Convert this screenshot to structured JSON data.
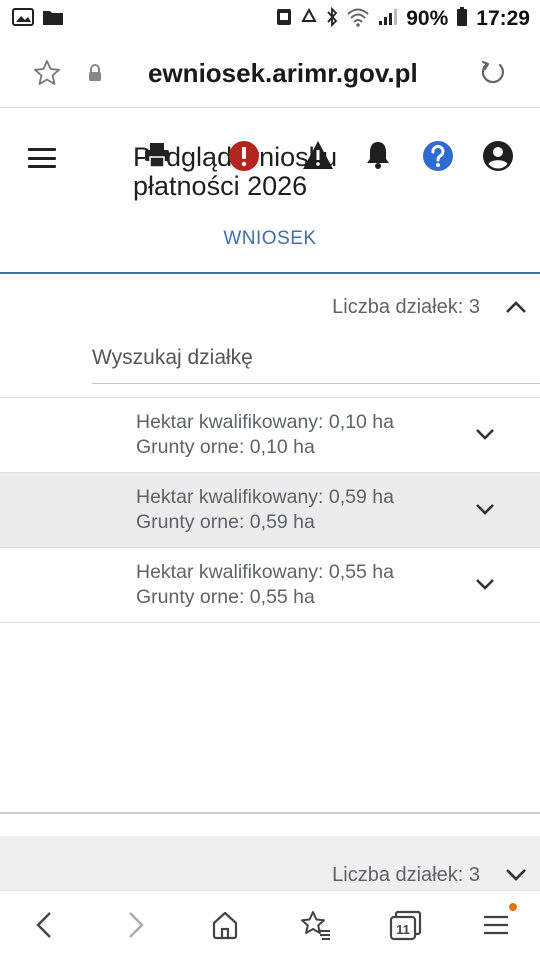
{
  "status_bar": {
    "battery_percent": "90%",
    "time": "17:29"
  },
  "browser": {
    "url": "ewniosek.arimr.gov.pl"
  },
  "header": {
    "title": "Podgląd wniosku płatności 2026",
    "tab_label": "WNIOSEK"
  },
  "parcels_section": {
    "count_label": "Liczba działek: 3",
    "search_placeholder": "Wyszukaj działkę",
    "items": [
      {
        "line1": "Hektar kwalifikowany: 0,10 ha",
        "line2": "Grunty orne: 0,10 ha"
      },
      {
        "line1": "Hektar kwalifikowany: 0,59 ha",
        "line2": "Grunty orne: 0,59 ha"
      },
      {
        "line1": "Hektar kwalifikowany: 0,55 ha",
        "line2": "Grunty orne: 0,55 ha"
      }
    ]
  },
  "next_section": {
    "count_label": "Liczba działek: 3"
  },
  "bottom_nav": {
    "tabs_count": "11"
  },
  "colors": {
    "accent": "#3f6ea8",
    "error": "#b3261e",
    "help": "#2f6bd1",
    "badge": "#e8711a"
  }
}
